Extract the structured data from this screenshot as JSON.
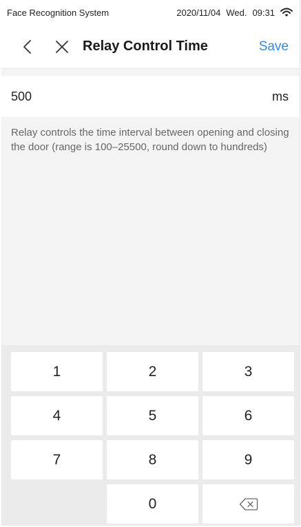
{
  "status_bar": {
    "app_name": "Face Recognition System",
    "date": "2020/11/04",
    "weekday": "Wed.",
    "time": "09:31"
  },
  "nav": {
    "title": "Relay Control Time",
    "save_label": "Save"
  },
  "relay_time": {
    "value": "500",
    "unit": "ms"
  },
  "hint": "Relay controls the time interval between opening and closing the door (range is 100–25500, round down to hundreds)",
  "keypad": {
    "keys": [
      "1",
      "2",
      "3",
      "4",
      "5",
      "6",
      "7",
      "8",
      "9",
      "",
      "0",
      "backspace"
    ]
  },
  "colors": {
    "accent": "#2f8bf5",
    "background": "#f4f4f4",
    "keypad_background": "#ebebeb"
  }
}
